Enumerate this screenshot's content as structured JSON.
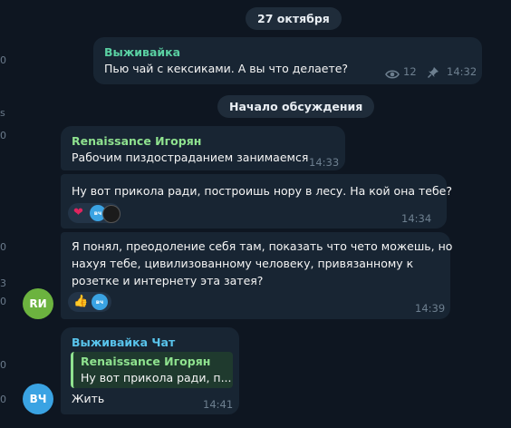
{
  "dates": {
    "date_pill": "27 октября",
    "discussion_pill": "Начало обсуждения"
  },
  "pinned_post": {
    "author": "Выживайка",
    "text": "Пью чай с кексиками. А вы что делаете?",
    "views": "12",
    "time": "14:32",
    "author_color": "#5ad0a2"
  },
  "messages": [
    {
      "author": "Renaissance Игорян",
      "text": "Рабочим пиздостраданием занимаемся",
      "time": "14:33",
      "author_color": "#8fe28f"
    },
    {
      "text": "Ну вот прикола ради, построишь нору в лесу. На кой она тебе?",
      "time": "14:34",
      "reactions": [
        {
          "emoji": "❤",
          "avatar": "вч"
        }
      ]
    },
    {
      "text_lines": [
        "Я понял, преодоление себя там, показать что чето можешь, но",
        "нахуя тебе, цивилизованному человеку, привязанному к",
        "розетке и интернету эта затея?"
      ],
      "time": "14:39",
      "reactions": [
        {
          "emoji": "👍",
          "avatar": "вч"
        }
      ],
      "avatar": "RИ",
      "avatar_color": "#6cb33f"
    },
    {
      "author": "Выживайка Чат",
      "author_color": "#59c4ec",
      "reply": {
        "author": "Renaissance Игорян",
        "text": "Ну вот прикола ради, п..."
      },
      "text": "Жить",
      "time": "14:41",
      "avatar": "ВЧ",
      "avatar_color": "#3aa3e3"
    }
  ],
  "edge_glyphs": [
    "0",
    "s",
    "0",
    "0",
    "3",
    "0",
    "0",
    "0"
  ]
}
